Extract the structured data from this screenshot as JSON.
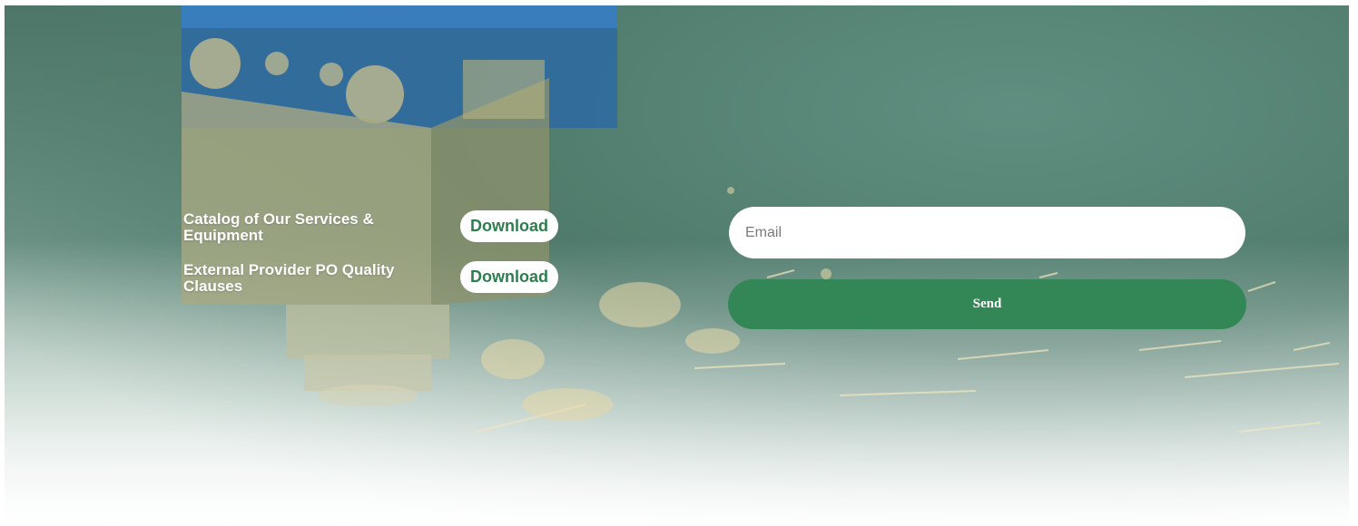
{
  "documents": [
    {
      "label": "Catalog of Our Services & Equipment",
      "action": "Download"
    },
    {
      "label": "External Provider PO Quality Clauses",
      "action": "Download"
    }
  ],
  "form": {
    "email_placeholder": "Email",
    "send_label": "Send"
  },
  "colors": {
    "accent": "#338655",
    "download_text": "#2e7d4f",
    "background_top": "#4c7567"
  }
}
